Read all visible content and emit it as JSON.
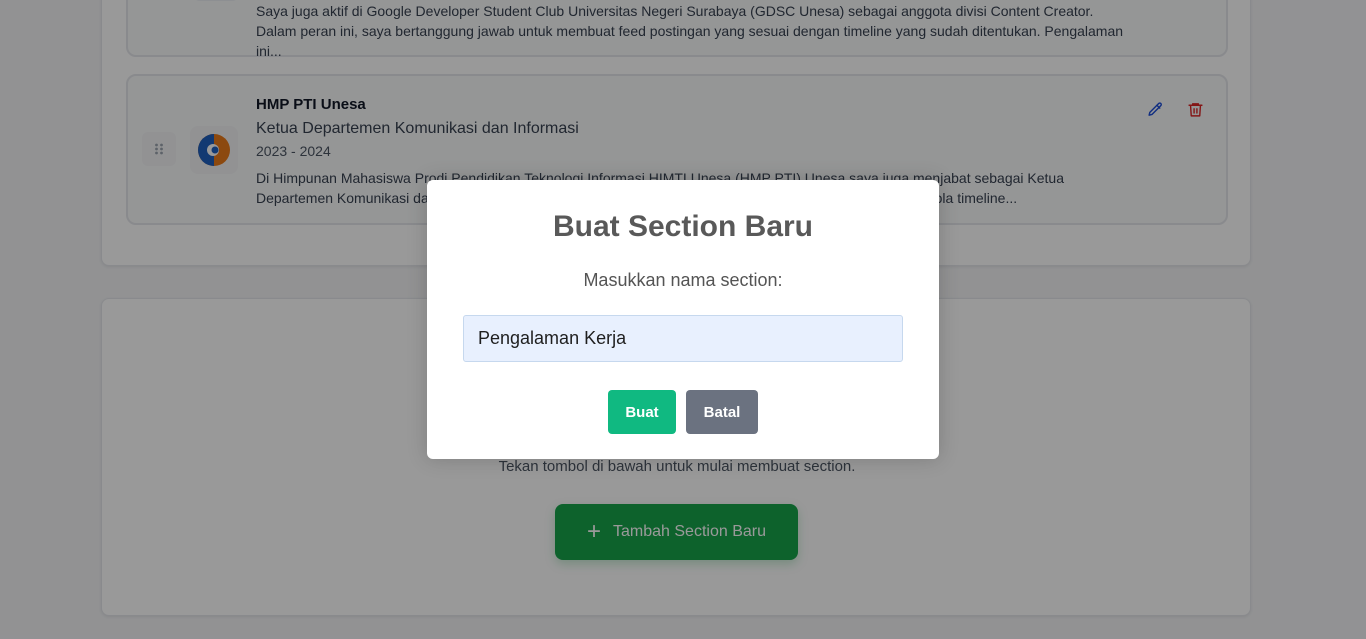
{
  "experiences": [
    {
      "description": "Saya juga aktif di Google Developer Student Club Universitas Negeri Surabaya (GDSC Unesa) sebagai anggota divisi Content Creator. Dalam peran ini, saya bertanggung jawab untuk membuat feed postingan yang sesuai dengan timeline yang sudah ditentukan. Pengalaman ini..."
    },
    {
      "organization": "HMP PTI Unesa",
      "role": "Ketua Departemen Komunikasi dan Informasi",
      "period": "2023 - 2024",
      "description": "Di Himpunan Mahasiswa Prodi Pendidikan Teknologi Informasi HIMTI Unesa (HMP PTI) Unesa saya juga menjabat sebagai Ketua Departemen Komunikasi dan Informasi, yang bertanggung jawab untuk mengatur feed Instagram dan mengelola timeline..."
    }
  ],
  "empty_state": {
    "hint": "Tekan tombol di bawah untuk mulai membuat section.",
    "add_button_label": "Tambah Section Baru"
  },
  "modal": {
    "title": "Buat Section Baru",
    "label": "Masukkan nama section:",
    "input_value": "Pengalaman Kerja",
    "confirm_label": "Buat",
    "cancel_label": "Batal"
  },
  "colors": {
    "confirm": "#10b981",
    "cancel": "#6b7280",
    "add_button": "#16a34a",
    "edit_icon": "#1d4ed8",
    "delete_icon": "#dc2626"
  },
  "icons": [
    "drag-handle-icon",
    "org-logo",
    "edit-icon",
    "trash-icon",
    "plus-icon"
  ]
}
